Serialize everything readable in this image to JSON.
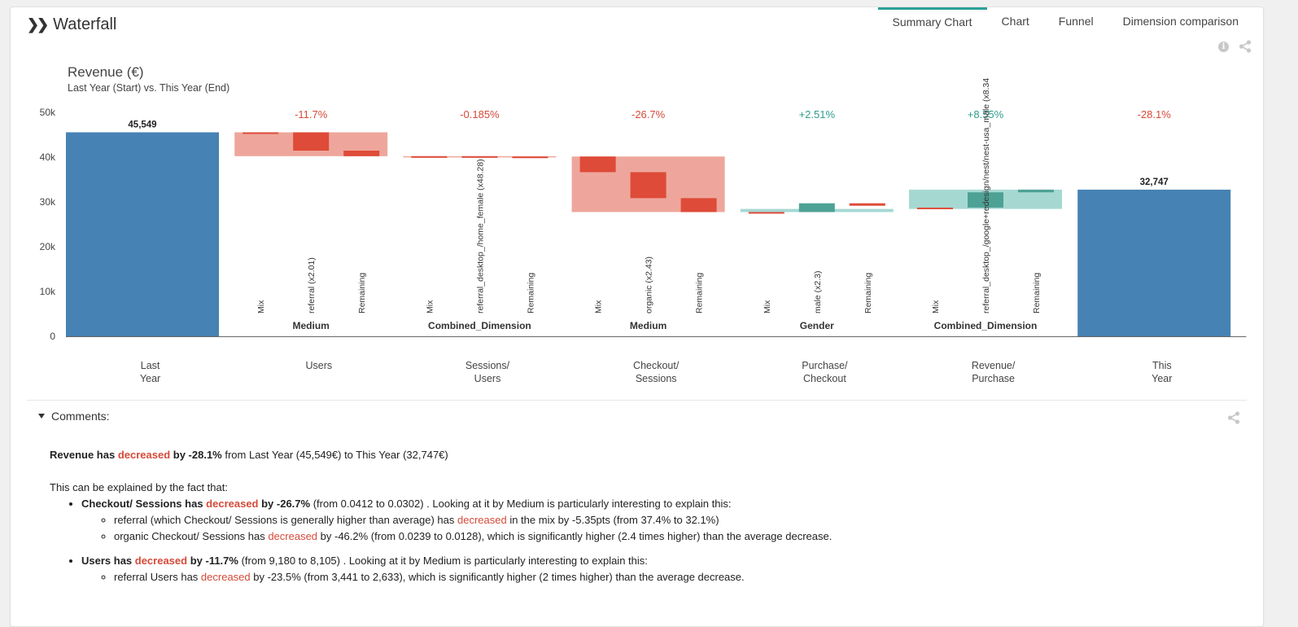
{
  "header": {
    "title": "Waterfall",
    "tabs": [
      {
        "label": "Summary Chart",
        "active": true
      },
      {
        "label": "Chart",
        "active": false
      },
      {
        "label": "Funnel",
        "active": false
      },
      {
        "label": "Dimension comparison",
        "active": false
      }
    ]
  },
  "chart_data": {
    "type": "bar",
    "title": "Revenue (€)",
    "subtitle": "Last Year (Start) vs. This Year (End)",
    "ylim": [
      0,
      50000
    ],
    "yticks": [
      0,
      10000,
      20000,
      30000,
      40000,
      50000
    ],
    "ytick_labels": [
      "0",
      "10k",
      "20k",
      "30k",
      "40k",
      "50k"
    ],
    "categories": [
      "Last\nYear",
      "Users",
      "Sessions/\nUsers",
      "Checkout/\nSessions",
      "Purchase/\nCheckout",
      "Revenue/\nPurchase",
      "This\nYear"
    ],
    "start": {
      "value": 45549,
      "label": "45,549"
    },
    "end": {
      "value": 32747,
      "label": "32,747"
    },
    "colors": {
      "total": "#4682b4",
      "neg_bg": "#eea69c",
      "neg_sub": "#de4b38",
      "pos_bg": "#a6d8d2",
      "pos_sub": "#4ea195",
      "neg_text": "#d64a38",
      "pos_text": "#2e9c8c"
    },
    "steps": [
      {
        "change": "-11.7%",
        "from": 45549,
        "to": 40217,
        "dimension": "Medium",
        "subs": [
          {
            "label": "Mix",
            "from": 45549,
            "to": 45350
          },
          {
            "label": "referral (x2.01)",
            "from": 45549,
            "to": 41450
          },
          {
            "label": "Remaining",
            "from": 41450,
            "to": 40217
          }
        ]
      },
      {
        "change": "-0.185%",
        "from": 40217,
        "to": 40142,
        "dimension": "Combined_Dimension",
        "subs": [
          {
            "label": "Mix",
            "from": 40217,
            "to": 40000
          },
          {
            "label": "referral_desktop_/home_female (x48.28)",
            "from": 40217,
            "to": 40000
          },
          {
            "label": "Remaining",
            "from": 40142,
            "to": 40000
          }
        ]
      },
      {
        "change": "-26.7%",
        "from": 40142,
        "to": 27742,
        "dimension": "Medium",
        "subs": [
          {
            "label": "Mix",
            "from": 40142,
            "to": 36650
          },
          {
            "label": "organic (x2.43)",
            "from": 36650,
            "to": 30850
          },
          {
            "label": "Remaining",
            "from": 30850,
            "to": 27742
          }
        ]
      },
      {
        "change": "+2.51%",
        "from": 27742,
        "to": 28438,
        "dimension": "Gender",
        "subs": [
          {
            "label": "Mix",
            "from": 27742,
            "to": 27450
          },
          {
            "label": "male (x2.3)",
            "from": 27742,
            "to": 29700
          },
          {
            "label": "Remaining",
            "from": 29700,
            "to": 29150
          }
        ]
      },
      {
        "change": "+8.55%",
        "from": 28438,
        "to": 32747,
        "dimension": "Combined_Dimension",
        "subs": [
          {
            "label": "Mix",
            "from": 28738,
            "to": 28438
          },
          {
            "label": "referral_desktop_/google+redesign/nest/nest-usa_male (x8.34",
            "from": 28738,
            "to": 32147
          },
          {
            "label": "Remaining",
            "from": 32147,
            "to": 32747
          }
        ]
      }
    ],
    "final_change": "-28.1%"
  },
  "comments": {
    "title": "Comments:",
    "summary": {
      "a": "Revenue has ",
      "b": "decreased",
      "c": " by -28.1%",
      "d": " from Last Year (45,549€) to This Year (32,747€)"
    },
    "intro": "This can be explained by the fact that:",
    "item1": {
      "a": "Checkout/ Sessions has ",
      "b": "decreased",
      "c": " by -26.7%",
      "d": " (from 0.0412 to 0.0302) . Looking at it by Medium is particularly interesting to explain this:",
      "sub1": {
        "a": "referral (which Checkout/ Sessions is generally higher than average) has ",
        "b": "decreased",
        "c": " in the mix by -5.35pts (from 37.4% to 32.1%)"
      },
      "sub2": {
        "a": "organic Checkout/ Sessions has ",
        "b": "decreased",
        "c": " by -46.2% (from 0.0239 to 0.0128), which is significantly higher (2.4 times higher) than the average decrease."
      }
    },
    "item2": {
      "a": "Users has ",
      "b": "decreased",
      "c": " by -11.7%",
      "d": " (from 9,180 to 8,105) . Looking at it by Medium is particularly interesting to explain this:",
      "sub1": {
        "a": "referral Users has ",
        "b": "decreased",
        "c": " by -23.5% (from 3,441 to 2,633), which is significantly higher (2 times higher) than the average decrease."
      }
    }
  }
}
